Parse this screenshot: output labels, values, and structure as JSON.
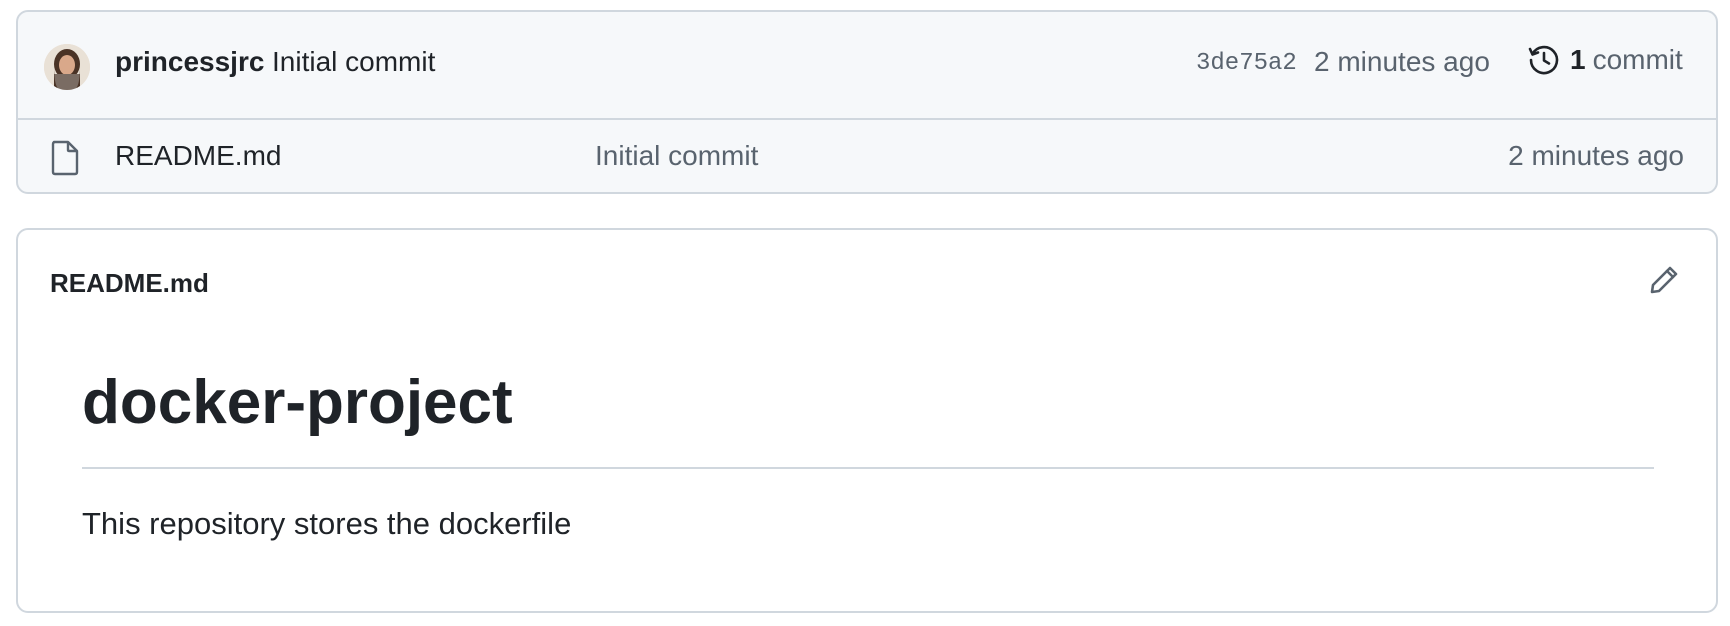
{
  "latest_commit": {
    "author": "princessjrc",
    "message": "Initial commit",
    "sha": "3de75a2",
    "time": "2 minutes ago",
    "history": {
      "count": "1",
      "label": "commit",
      "icon": "history-icon"
    },
    "avatar_icon": "avatar"
  },
  "files": [
    {
      "icon": "file-icon",
      "name": "README.md",
      "commit_message": "Initial commit",
      "time": "2 minutes ago"
    }
  ],
  "readme": {
    "header_title": "README.md",
    "edit_icon": "pencil-icon",
    "heading": "docker-project",
    "paragraph": "This repository stores the dockerfile"
  },
  "colors": {
    "border": "#d0d7de",
    "header_bg": "#f6f8fa",
    "text_primary": "#1f2328",
    "text_muted": "#59636e"
  }
}
